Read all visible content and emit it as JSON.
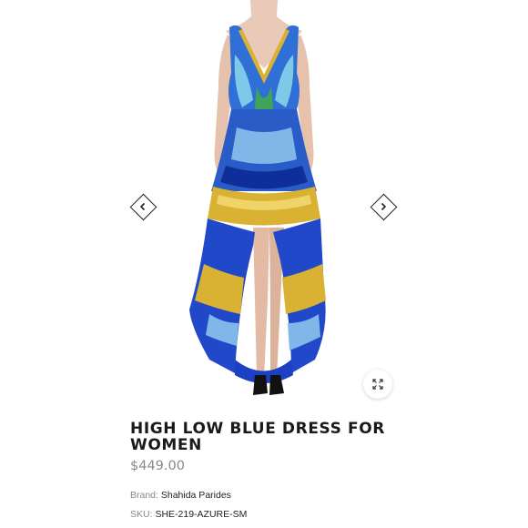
{
  "product": {
    "title": "HIGH LOW BLUE DRESS FOR WOMEN",
    "price": "$449.00",
    "brand_label": "Brand:",
    "brand_value": "Shahida Parides",
    "sku_label": "SKU:",
    "sku_value": "SHE-219-AZURE-SM"
  },
  "icons": {
    "prev": "chevron-left-icon",
    "next": "chevron-right-icon",
    "zoom": "expand-icon"
  },
  "colors": {
    "royal_blue": "#1c3fc4",
    "gold": "#d9b233",
    "sky": "#6fb8e6"
  }
}
